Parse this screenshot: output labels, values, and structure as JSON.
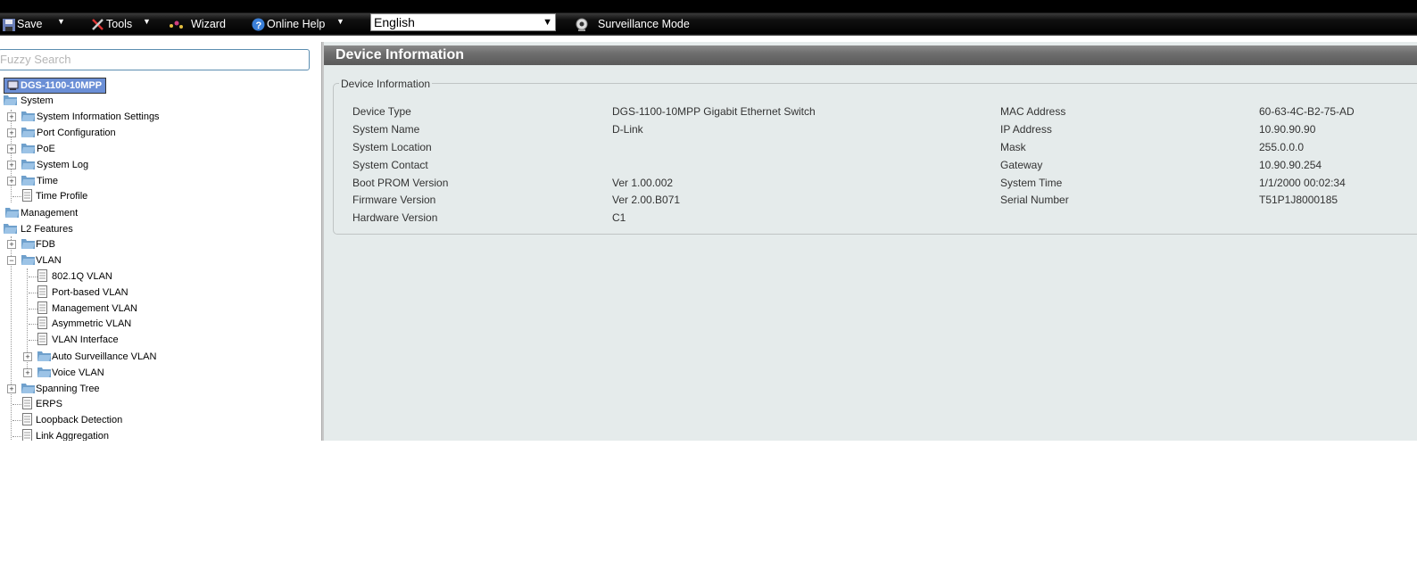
{
  "toolbar": {
    "save": "Save",
    "tools": "Tools",
    "wizard": "Wizard",
    "online_help": "Online Help",
    "language": "English",
    "surveillance": "Surveillance Mode"
  },
  "search": {
    "placeholder": "Fuzzy Search"
  },
  "tree": {
    "root": "DGS-1100-10MPP",
    "system": "System",
    "system_information_settings": "System Information Settings",
    "port_configuration": "Port Configuration",
    "poe": "PoE",
    "system_log": "System Log",
    "time": "Time",
    "time_profile": "Time Profile",
    "management": "Management",
    "l2_features": "L2 Features",
    "fdb": "FDB",
    "vlan": "VLAN",
    "vlan_8021q": "802.1Q VLAN",
    "port_based_vlan": "Port-based VLAN",
    "management_vlan": "Management VLAN",
    "asymmetric_vlan": "Asymmetric VLAN",
    "vlan_interface": "VLAN Interface",
    "auto_surveillance_vlan": "Auto Surveillance VLAN",
    "voice_vlan": "Voice VLAN",
    "spanning_tree": "Spanning Tree",
    "erps": "ERPS",
    "loopback_detection": "Loopback Detection",
    "link_aggregation": "Link Aggregation"
  },
  "main": {
    "title": "Device Information",
    "legend": "Device Information",
    "left_fields": [
      {
        "label": "Device Type",
        "value": "DGS-1100-10MPP Gigabit Ethernet Switch"
      },
      {
        "label": "System Name",
        "value": "D-Link"
      },
      {
        "label": "System Location",
        "value": ""
      },
      {
        "label": "System Contact",
        "value": ""
      },
      {
        "label": "Boot PROM Version",
        "value": "Ver 1.00.002"
      },
      {
        "label": "Firmware Version",
        "value": "Ver 2.00.B071"
      },
      {
        "label": "Hardware Version",
        "value": "C1"
      }
    ],
    "right_fields": [
      {
        "label": "MAC Address",
        "value": "60-63-4C-B2-75-AD"
      },
      {
        "label": "IP Address",
        "value": "10.90.90.90"
      },
      {
        "label": "Mask",
        "value": "255.0.0.0"
      },
      {
        "label": "Gateway",
        "value": "10.90.90.254"
      },
      {
        "label": "System Time",
        "value": "1/1/2000 00:02:34"
      },
      {
        "label": "Serial Number",
        "value": "T51P1J8000185"
      }
    ]
  }
}
